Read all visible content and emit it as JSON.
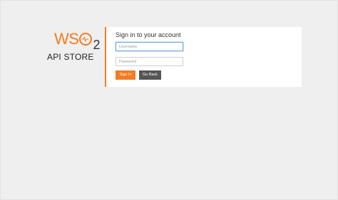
{
  "logo": {
    "brand_letters": "WS",
    "brand_suffix": "2",
    "product": "API STORE"
  },
  "login": {
    "title": "Sign in to your account",
    "username": {
      "placeholder": "Username",
      "value": ""
    },
    "password": {
      "placeholder": "Password",
      "value": ""
    },
    "signin_label": "Sign In",
    "goback_label": "Go Back"
  },
  "colors": {
    "accent": "#f47b20",
    "secondary_button": "#555555",
    "background": "#efefef",
    "focus_border": "#6aa6e8"
  }
}
